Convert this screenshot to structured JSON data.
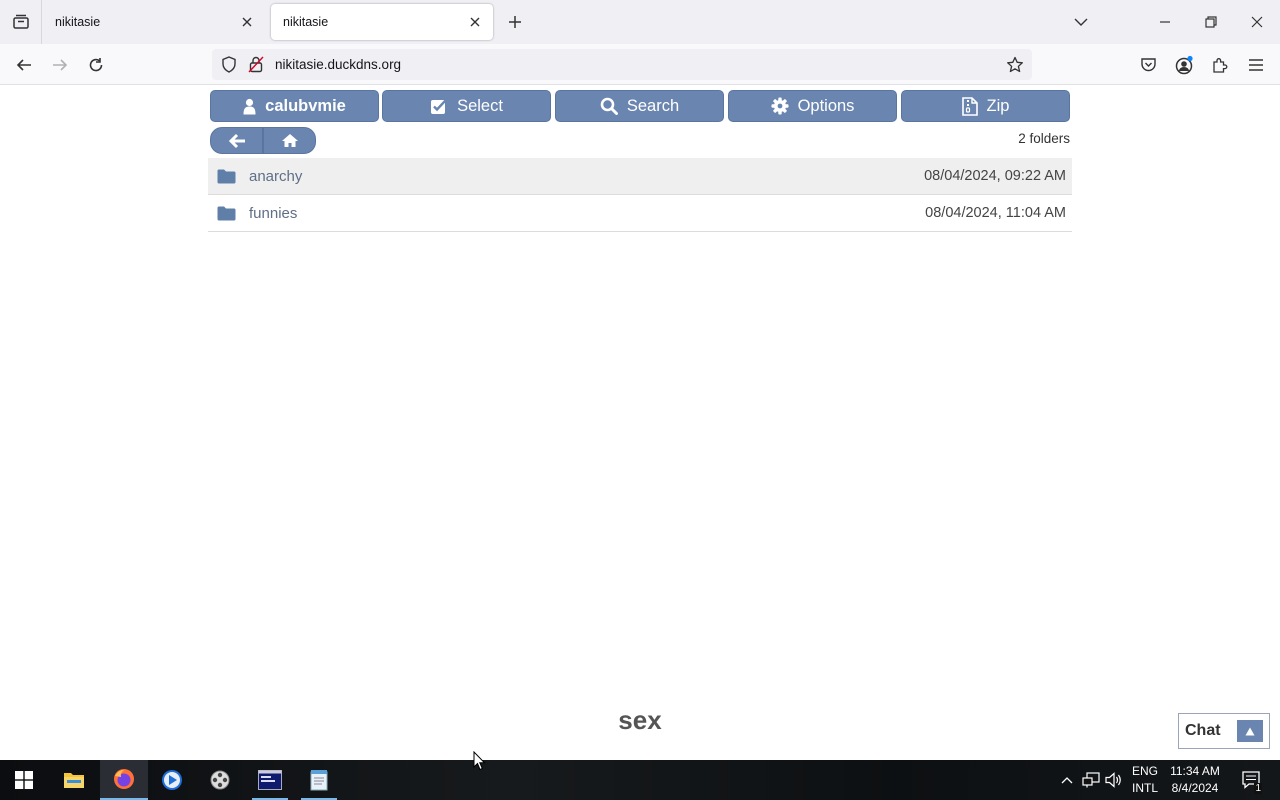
{
  "browser": {
    "tabs": [
      {
        "title": "nikitasie"
      },
      {
        "title": "nikitasie"
      }
    ],
    "url": "nikitasie.duckdns.org"
  },
  "toolbar": {
    "user_label": "calubvmie",
    "select_label": "Select",
    "search_label": "Search",
    "options_label": "Options",
    "zip_label": "Zip"
  },
  "listing": {
    "count_text": "2 folders",
    "folders": [
      {
        "name": "anarchy",
        "date": "08/04/2024, 09:22 AM"
      },
      {
        "name": "funnies",
        "date": "08/04/2024, 11:04 AM"
      }
    ]
  },
  "footer_text": "sex",
  "chat": {
    "label": "Chat"
  },
  "taskbar": {
    "apps": [
      "start-icon",
      "file-explorer-icon",
      "firefox-icon",
      "media-player-icon",
      "film-reel-icon",
      "terminal-icon",
      "notepad-icon"
    ],
    "language": {
      "line1": "ENG",
      "line2": "INTL"
    },
    "clock": {
      "time": "11:34 AM",
      "date": "8/4/2024"
    },
    "notifications": "1"
  },
  "colors": {
    "accent": "#6a86b0",
    "folder_icon": "#5f7fa8",
    "taskbar_highlight": "#76b9ed"
  }
}
